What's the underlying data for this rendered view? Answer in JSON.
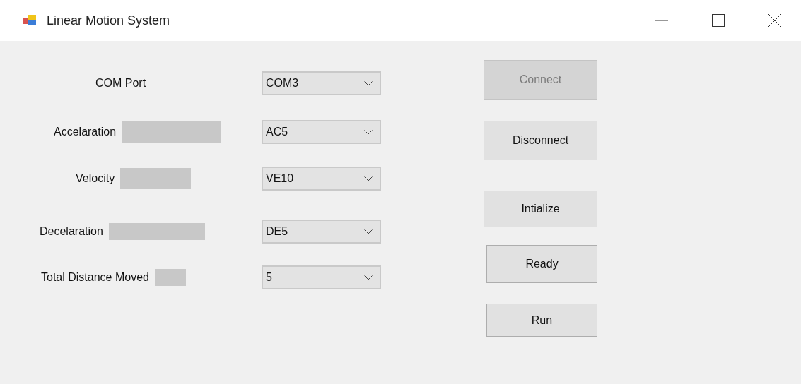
{
  "window": {
    "title": "Linear Motion System"
  },
  "fields": [
    {
      "label": "COM Port",
      "has_readout": false,
      "value": "COM3"
    },
    {
      "label": "Accelaration",
      "has_readout": true,
      "value": "AC5"
    },
    {
      "label": "Velocity",
      "has_readout": true,
      "value": "VE10"
    },
    {
      "label": "Decelaration",
      "has_readout": true,
      "value": "DE5"
    },
    {
      "label": "Total Distance Moved",
      "has_readout": true,
      "value": "5"
    }
  ],
  "buttons": [
    {
      "label": "Connect",
      "disabled": true
    },
    {
      "label": "Disconnect",
      "disabled": false
    },
    {
      "label": "Intialize",
      "disabled": false
    },
    {
      "label": "Ready",
      "disabled": false
    },
    {
      "label": "Run",
      "disabled": false
    }
  ]
}
